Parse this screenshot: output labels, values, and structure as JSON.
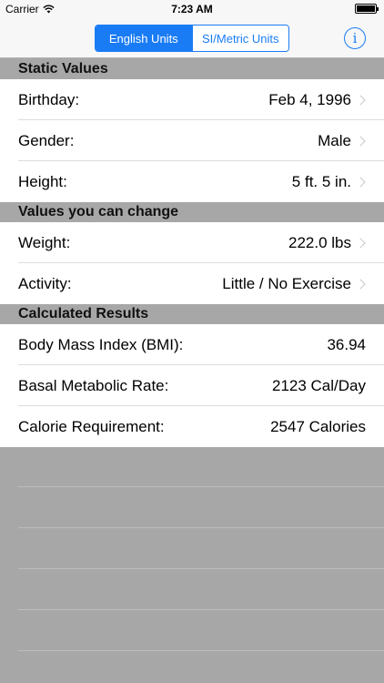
{
  "status_bar": {
    "carrier": "Carrier",
    "time": "7:23 AM"
  },
  "nav": {
    "segments": [
      "English Units",
      "SI/Metric Units"
    ],
    "selected_segment": "English Units",
    "info_glyph": "i"
  },
  "sections": {
    "static": {
      "header": "Static Values",
      "rows": [
        {
          "label": "Birthday:",
          "value": "Feb 4, 1996"
        },
        {
          "label": "Gender:",
          "value": "Male"
        },
        {
          "label": "Height:",
          "value": "5 ft. 5 in."
        }
      ]
    },
    "changeable": {
      "header": "Values you can change",
      "rows": [
        {
          "label": "Weight:",
          "value": "222.0 lbs"
        },
        {
          "label": "Activity:",
          "value": "Little / No Exercise"
        }
      ]
    },
    "calculated": {
      "header": "Calculated Results",
      "rows": [
        {
          "label": "Body Mass Index (BMI):",
          "value": "36.94"
        },
        {
          "label": "Basal Metabolic Rate:",
          "value": "2123 Cal/Day"
        },
        {
          "label": "Calorie Requirement:",
          "value": "2547 Calories"
        }
      ]
    }
  },
  "colors": {
    "accent": "#1a7cf5",
    "section_header_bg": "#a7a7a7"
  }
}
